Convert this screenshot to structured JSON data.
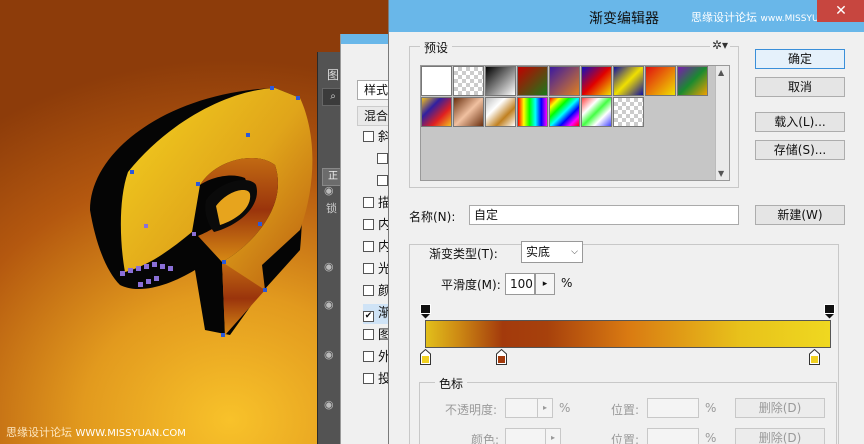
{
  "canvas": {
    "watermark_left": "思缘设计论坛",
    "watermark_url": "WWW.MISSYUAN.COM"
  },
  "layers_panel": {
    "title_glyph": "图",
    "search_glyph": "⌕",
    "button_glyph": "正",
    "lock_glyph": "锁"
  },
  "layer_style": {
    "style_header": "样式",
    "blend_header": "混合",
    "rows": [
      {
        "label": "斜",
        "checked": false,
        "indent": false
      },
      {
        "label": "",
        "checked": false,
        "indent": true
      },
      {
        "label": "",
        "checked": false,
        "indent": true
      },
      {
        "label": "描",
        "checked": false,
        "indent": false
      },
      {
        "label": "内",
        "checked": false,
        "indent": false
      },
      {
        "label": "内",
        "checked": false,
        "indent": false
      },
      {
        "label": "光",
        "checked": false,
        "indent": false
      },
      {
        "label": "颜",
        "checked": false,
        "indent": false
      },
      {
        "label": "渐",
        "checked": true,
        "indent": false
      },
      {
        "label": "图",
        "checked": false,
        "indent": false
      },
      {
        "label": "外",
        "checked": false,
        "indent": false
      },
      {
        "label": "投",
        "checked": false,
        "indent": false
      }
    ]
  },
  "gradient_editor": {
    "title": "渐变编辑器",
    "watermark": "思缘设计论坛",
    "watermark_url": "www.MISSYUAN.com",
    "close_glyph": "✕",
    "presets_label": "预设",
    "presets_gear": "✲▾",
    "buttons": {
      "ok": "确定",
      "cancel": "取消",
      "load": "载入(L)...",
      "save": "存储(S)...",
      "new": "新建(W)"
    },
    "name_label": "名称(N):",
    "name_value": "自定",
    "type_label": "渐变类型(T):",
    "type_value": "实底",
    "smooth_label": "平滑度(M):",
    "smooth_value": "100",
    "smooth_unit": "%",
    "color_stops_label": "色标",
    "opacity_label": "不透明度:",
    "color_label": "颜色:",
    "position_label": "位置:",
    "percent": "%",
    "delete_label": "删除(D)"
  },
  "colors": {
    "titlebar": "#69b7e9",
    "stop_gold": "#f0d020",
    "stop_rust": "#a33a0c",
    "stop_orange": "#d97a12"
  }
}
